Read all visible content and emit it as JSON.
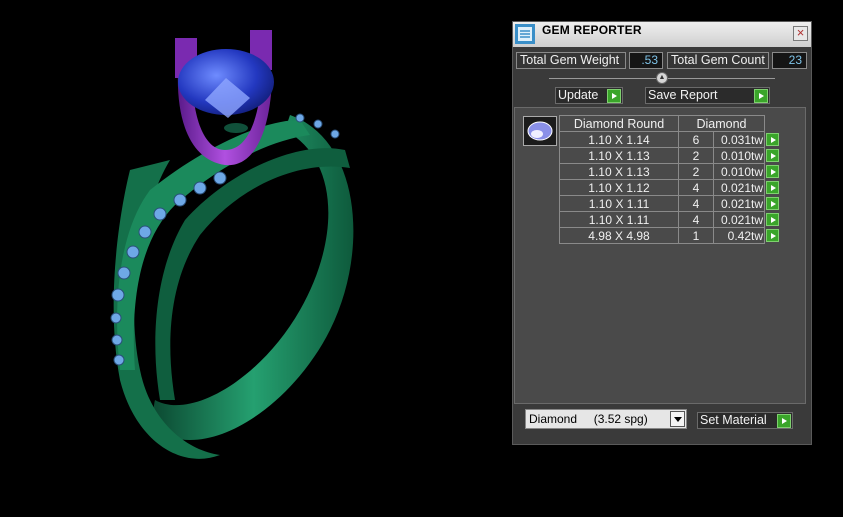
{
  "window": {
    "title": "GEM REPORTER",
    "close_symbol": "×"
  },
  "summary": {
    "total_gem_weight_label": "Total Gem Weight",
    "total_gem_weight_value": ".53",
    "total_gem_count_label": "Total Gem Count",
    "total_gem_count_value": "23"
  },
  "actions": {
    "update_label": "Update",
    "save_report_label": "Save Report"
  },
  "table": {
    "headers": [
      "Diamond Round",
      "Diamond"
    ],
    "rows": [
      {
        "size": "1.10 X 1.14",
        "count": "6",
        "weight": "0.031tw"
      },
      {
        "size": "1.10 X 1.13",
        "count": "2",
        "weight": "0.010tw"
      },
      {
        "size": "1.10 X 1.13",
        "count": "2",
        "weight": "0.010tw"
      },
      {
        "size": "1.10 X 1.12",
        "count": "4",
        "weight": "0.021tw"
      },
      {
        "size": "1.10 X 1.11",
        "count": "4",
        "weight": "0.021tw"
      },
      {
        "size": "1.10 X 1.11",
        "count": "4",
        "weight": "0.021tw"
      },
      {
        "size": "4.98 X 4.98",
        "count": "1",
        "weight": "0.42tw"
      }
    ]
  },
  "material": {
    "selected": "Diamond     (3.52 spg)",
    "set_material_label": "Set Material"
  },
  "colors": {
    "ring_green": "#1f8a5e",
    "prong_purple": "#8a2fc0",
    "gem_blue": "#2a3fc8",
    "accent_green": "#3aa52a"
  }
}
